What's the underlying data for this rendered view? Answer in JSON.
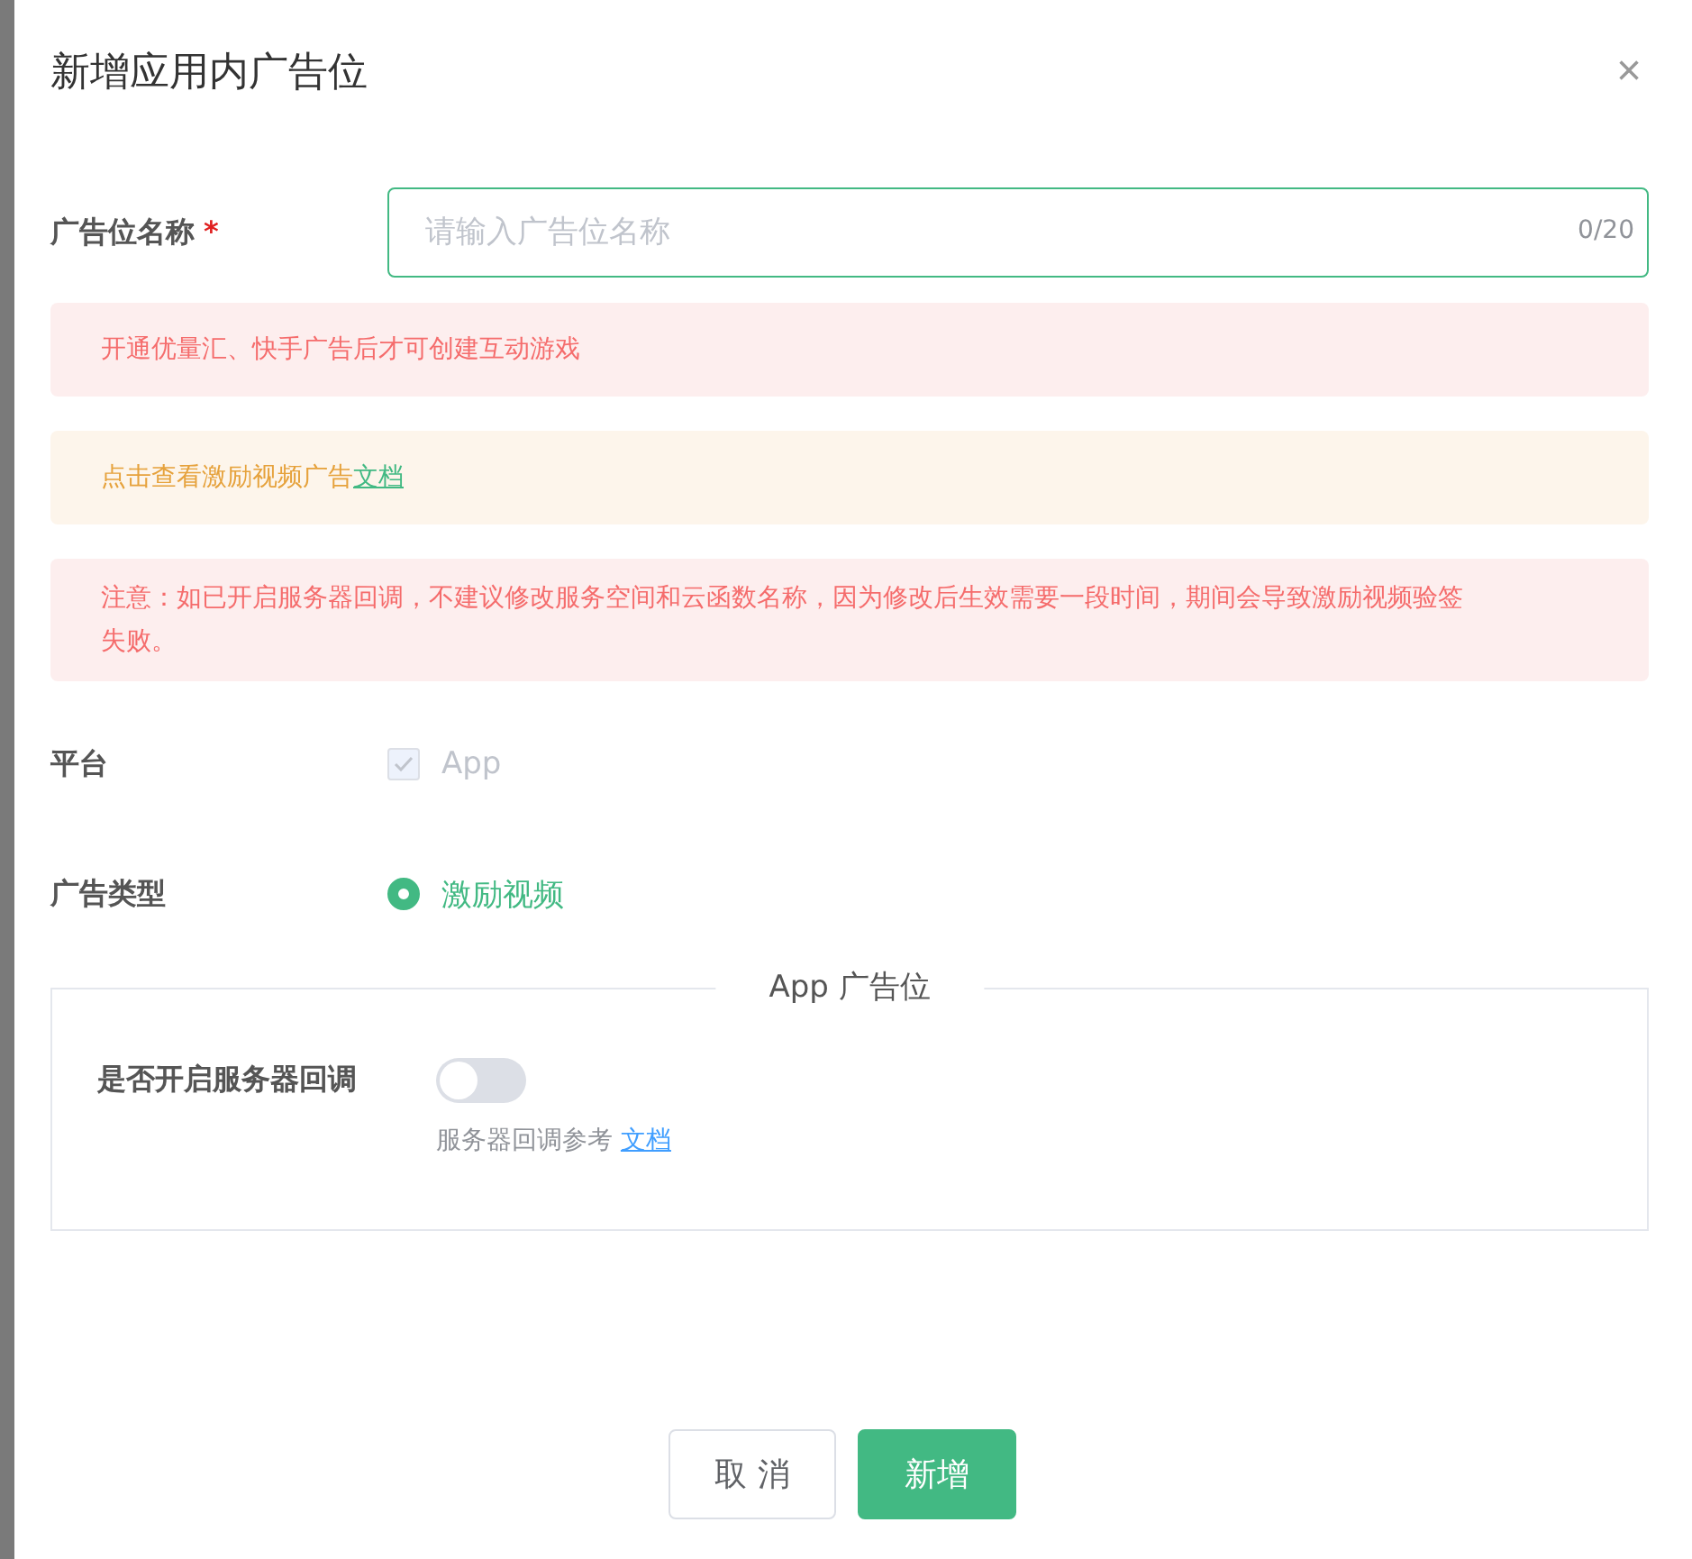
{
  "dialog": {
    "title": "新增应用内广告位",
    "close": "×"
  },
  "name_field": {
    "label": "广告位名称",
    "required_mark": "*",
    "placeholder": "请输入广告位名称",
    "counter": "0/20"
  },
  "alerts": [
    {
      "kind": "error",
      "text": "开通优量汇、快手广告后才可创建互动游戏"
    },
    {
      "kind": "warning",
      "text": "点击查看激励视频广告",
      "link": "文档"
    },
    {
      "kind": "error",
      "text": "注意：如已开启服务器回调，不建议修改服务空间和云函数名称，因为修改后生效需要一段时间，期间会导致激励视频验签失败。"
    }
  ],
  "platform": {
    "label": "平台",
    "options": [
      {
        "label": "App",
        "checked": true,
        "disabled": true
      }
    ]
  },
  "ad_type": {
    "label": "广告类型",
    "options": [
      {
        "label": "激励视频",
        "selected": true
      }
    ]
  },
  "app_section": {
    "legend": "App 广告位",
    "callback": {
      "label": "是否开启服务器回调",
      "on": false,
      "hint": "服务器回调参考",
      "link": "文档"
    }
  },
  "buttons": [
    {
      "label": "取 消",
      "kind": "default"
    },
    {
      "label": "新增",
      "kind": "primary"
    }
  ]
}
